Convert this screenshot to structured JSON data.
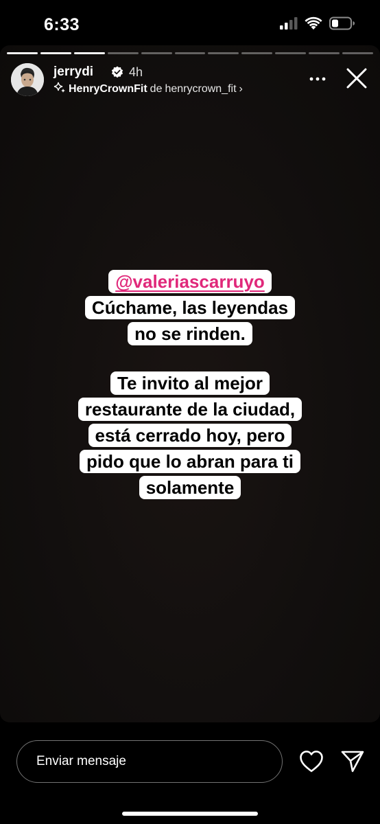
{
  "status_bar": {
    "time": "6:33",
    "icons": [
      "signal-icon",
      "wifi-icon",
      "battery-icon"
    ]
  },
  "story": {
    "progress": {
      "total_segments": 11,
      "completed_segments": 3
    },
    "user": {
      "username": "jerrydi",
      "verified": true,
      "time_ago": "4h"
    },
    "music": {
      "icon": "sparkle-icon",
      "title": "HenryCrownFit",
      "separator": "de",
      "author": "henrycrown_fit",
      "chevron": "›"
    },
    "captions": {
      "mention": "@valeriascarruyo",
      "block1_lines": [
        "Cúchame, las leyendas",
        "no se rinden."
      ],
      "block2_lines": [
        "Te invito al mejor",
        "restaurante de la ciudad,",
        "está cerrado hoy, pero",
        "pido que lo abran para ti",
        "solamente"
      ]
    },
    "colors": {
      "mention": "#e0287a",
      "background": "#120f0e",
      "sticker_bg": "#ffffff"
    }
  },
  "bottom_bar": {
    "message_placeholder": "Enviar mensaje",
    "icons": [
      "heart-icon",
      "send-icon"
    ]
  }
}
